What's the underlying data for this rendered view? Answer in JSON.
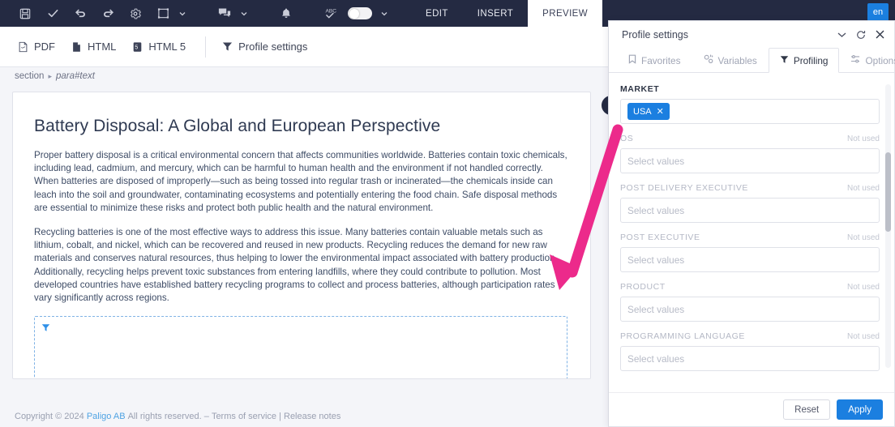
{
  "topbar": {
    "icons": [
      {
        "name": "save-icon",
        "label": "Save"
      },
      {
        "name": "check-icon",
        "label": "Approve"
      },
      {
        "name": "undo-icon",
        "label": "Undo"
      },
      {
        "name": "redo-icon",
        "label": "Redo"
      },
      {
        "name": "gear-icon",
        "label": "Settings"
      },
      {
        "name": "fullscreen-icon",
        "label": "Fullscreen"
      },
      {
        "name": "comment-icon",
        "label": "Comments"
      },
      {
        "name": "bell-icon",
        "label": "Notifications"
      },
      {
        "name": "spellcheck-icon",
        "label": "Spell check"
      }
    ],
    "tabs": [
      {
        "label": "EDIT",
        "active": false
      },
      {
        "label": "INSERT",
        "active": false
      },
      {
        "label": "PREVIEW",
        "active": true
      }
    ],
    "language_badge": "en"
  },
  "formatbar": {
    "items": [
      {
        "label": "PDF",
        "icon": "pdf-icon"
      },
      {
        "label": "HTML",
        "icon": "html-icon"
      },
      {
        "label": "HTML 5",
        "icon": "html5-icon"
      }
    ],
    "profile_settings_label": "Profile settings"
  },
  "breadcrumb": {
    "root": "section",
    "separator": "▸",
    "current": "para#text"
  },
  "document": {
    "title": "Battery Disposal: A Global and European Perspective",
    "paragraphs": [
      "Proper battery disposal is a critical environmental concern that affects communities worldwide. Batteries contain toxic chemicals, including lead, cadmium, and mercury, which can be harmful to human health and the environment if not handled correctly. When batteries are disposed of improperly—such as being tossed into regular trash or incinerated—the chemicals inside can leach into the soil and groundwater, contaminating ecosystems and potentially entering the food chain. Safe disposal methods are essential to minimize these risks and protect both public health and the natural environment.",
      "Recycling batteries is one of the most effective ways to address this issue. Many batteries contain valuable metals such as lithium, cobalt, and nickel, which can be recovered and reused in new products. Recycling reduces the demand for new raw materials and conserves natural resources, thus helping to lower the environmental impact associated with battery production. Additionally, recycling helps prevent toxic substances from entering landfills, where they could contribute to pollution. Most developed countries have established battery recycling programs to collect and process batteries, although participation rates vary significantly across regions."
    ],
    "filter_block_icon": "filter-funnel-icon"
  },
  "footer": {
    "copyright_prefix": "Copyright © 2024",
    "company": "Paligo AB",
    "rights": "All rights reserved.",
    "dash": "–",
    "terms": "Terms of service",
    "pipe": "|",
    "release_notes": "Release notes"
  },
  "panel": {
    "title": "Profile settings",
    "head_icons": [
      {
        "name": "chevron-down-icon"
      },
      {
        "name": "refresh-icon"
      },
      {
        "name": "close-icon"
      }
    ],
    "tabs": [
      {
        "label": "Favorites",
        "icon": "bookmark-icon",
        "active": false
      },
      {
        "label": "Variables",
        "icon": "variables-icon",
        "active": false
      },
      {
        "label": "Profiling",
        "icon": "filter-funnel-icon",
        "active": true
      },
      {
        "label": "Options",
        "icon": "sliders-icon",
        "active": false
      }
    ],
    "fields": [
      {
        "label": "MARKET",
        "active": true,
        "note": "",
        "chips": [
          "USA"
        ],
        "placeholder": ""
      },
      {
        "label": "OS",
        "active": false,
        "note": "Not used",
        "chips": [],
        "placeholder": "Select values"
      },
      {
        "label": "POST DELIVERY EXECUTIVE",
        "active": false,
        "note": "Not used",
        "chips": [],
        "placeholder": "Select values"
      },
      {
        "label": "POST EXECUTIVE",
        "active": false,
        "note": "Not used",
        "chips": [],
        "placeholder": "Select values"
      },
      {
        "label": "PRODUCT",
        "active": false,
        "note": "Not used",
        "chips": [],
        "placeholder": "Select values"
      },
      {
        "label": "PROGRAMMING LANGUAGE",
        "active": false,
        "note": "Not used",
        "chips": [],
        "placeholder": "Select values"
      }
    ],
    "buttons": {
      "reset": "Reset",
      "apply": "Apply"
    }
  },
  "annotation": {
    "arrow_color": "#ec2a8b"
  }
}
